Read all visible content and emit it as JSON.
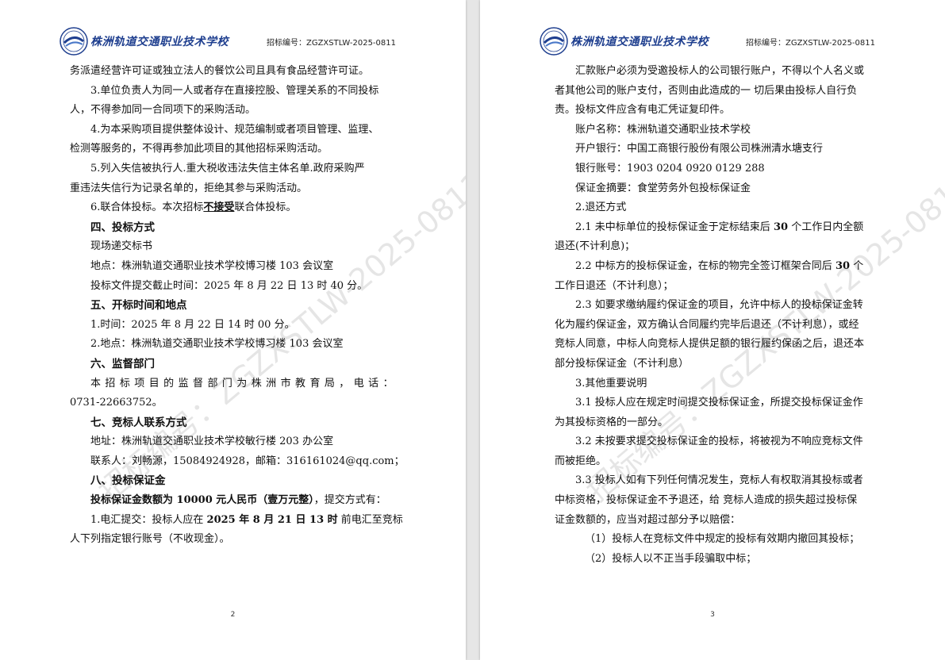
{
  "header": {
    "school_name": "株洲轨道交通职业技术学校",
    "bid_number": "招标编号：ZGZXSTLW-2025-0811"
  },
  "watermark": "招标编号：ZGZXSTLW-2025-0811",
  "left_page": {
    "page_number": "2",
    "lines": [
      "务派遣经营许可证或独立法人的餐饮公司且具有食品经营许可证。",
      "3.单位负责人为同一人或者存在直接控股、管理关系的不同投标",
      "人，不得参加同一合同项下的采购活动。",
      "4.为本采购项目提供整体设计、规范编制或者项目管理、监理、",
      "检测等服务的，不得再参加此项目的其他招标采购活动。",
      "5.列入失信被执行人.重大税收违法失信主体名单.政府采购严",
      "重违法失信行为记录名单的，拒绝其参与采购活动。",
      "6.联合体投标。本次招标",
      "不接受",
      "联合体投标。",
      "四、投标方式",
      "现场递交标书",
      "地点：株洲轨道交通职业技术学校博习楼 103 会议室",
      "投标文件提交截止时间：2025 年 8 月 22 日 13 时 40 分。",
      "五、开标时间和地点",
      "1.时间：2025 年 8 月 22 日 14 时 00 分。",
      "2.地点：株洲轨道交通职业技术学校博习楼 103 会议室",
      "六、监督部门",
      "本招标项目的监督部门为株洲市教育局，电话：",
      "0731-22663752。",
      "七、竞标人联系方式",
      "地址：株洲轨道交通职业技术学校敏行楼 203 办公室",
      "联系人：刘畅源，15084924928，邮箱：316161024@qq.com；",
      "八、投标保证金",
      "投标保证金数额为 10000 元人民币（壹万元整）",
      "，提交方式有：",
      "1.电汇提交：投标人应在",
      "2025 年 8 月 21 日 13 时",
      "前电汇至竞标",
      "人下列指定银行账号（不收现金）。"
    ]
  },
  "right_page": {
    "page_number": "3",
    "lines": [
      "汇款账户必须为受邀投标人的公司银行账户，不得以个人名义或",
      "者其他公司的账户支付，否则由此造成的一 切后果由投标人自行负",
      "责。投标文件应含有电汇凭证复印件。",
      "账户名称：株洲轨道交通职业技术学校",
      "开户银行：中国工商银行股份有限公司株洲清水塘支行",
      "银行账号：1903 0204 0920 0129 288",
      "保证金摘要：食堂劳务外包投标保证金",
      "2.退还方式",
      "2.1 未中标单位的投标保证金于定标结束后",
      "30",
      "个工作日内全额",
      "退还(不计利息)；",
      "2.2 中标方的投标保证金，在标的物完全签订框架合同后",
      "30",
      "个",
      "工作日退还（不计利息）；",
      "2.3 如要求缴纳履约保证金的项目，允许中标人的投标保证金转",
      "化为履约保证金，双方确认合同履约完毕后退还（不计利息），或经",
      "竞标人同意，中标人向竞标人提供足额的银行履约保函之后，退还本",
      "部分投标保证金（不计利息）",
      "3.其他重要说明",
      "3.1 投标人应在规定时间提交投标保证金，所提交投标保证金作",
      "为其投标资格的一部分。",
      "3.2 未按要求提交投标保证金的投标，将被视为不响应竞标文件",
      "而被拒绝。",
      "3.3 投标人如有下列任何情况发生，竞标人有权取消其投标或者",
      "中标资格，投标保证金不予退还，给 竞标人造成的损失超过投标保",
      "证金数额的，应当对超过部分予以赔偿：",
      "（1）投标人在竞标文件中规定的投标有效期内撤回其投标；",
      "（2）投标人以不正当手段骗取中标；"
    ]
  }
}
